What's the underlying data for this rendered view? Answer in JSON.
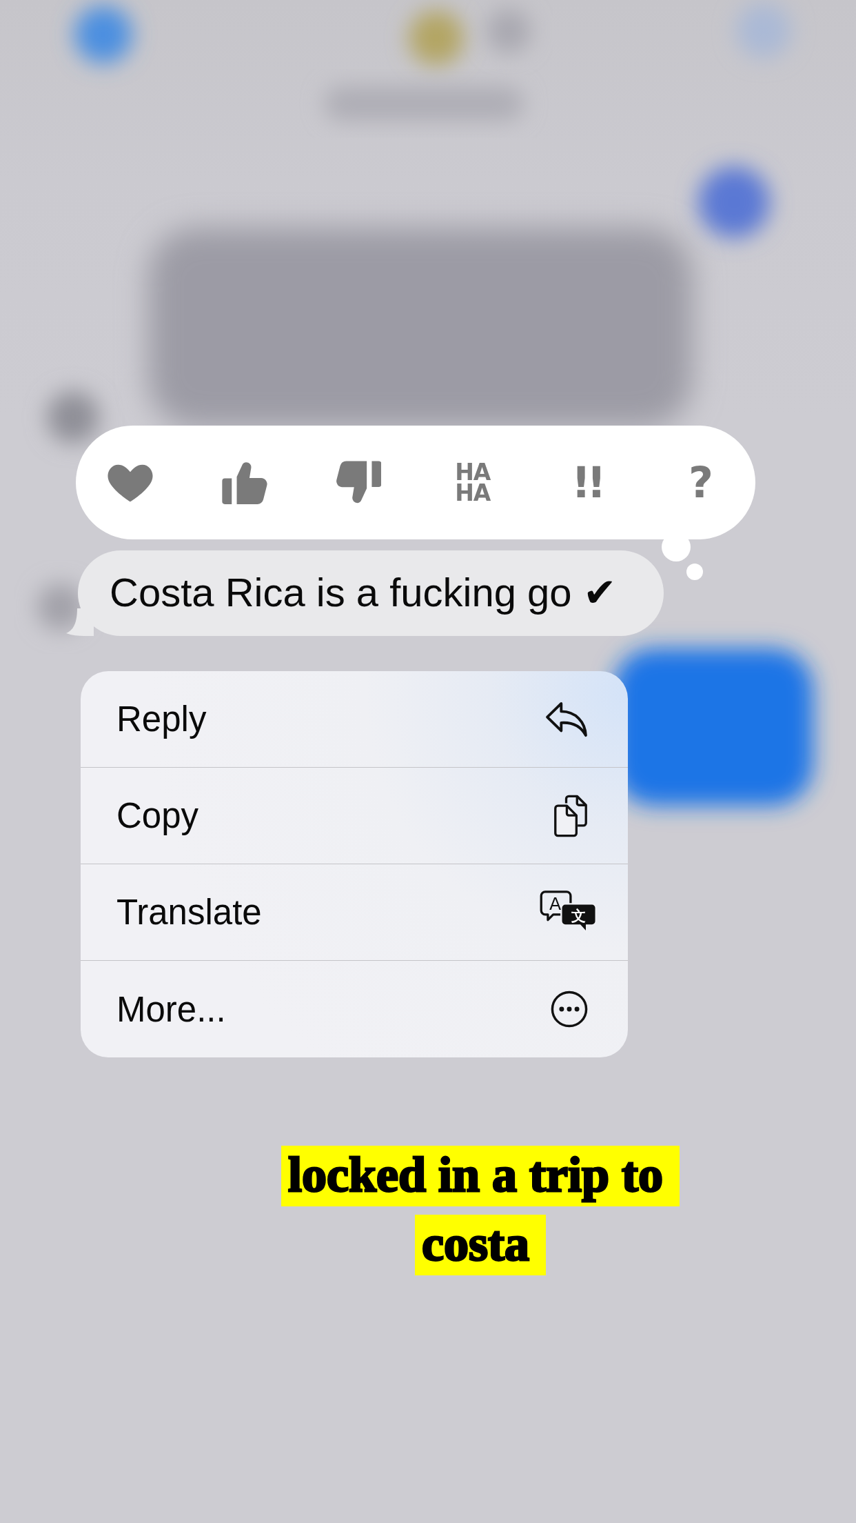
{
  "reactions": [
    {
      "kind": "heart",
      "selected": false
    },
    {
      "kind": "thumbs_up",
      "selected": false
    },
    {
      "kind": "thumbs_down",
      "selected": false
    },
    {
      "kind": "haha",
      "text": "HA HA",
      "selected": false
    },
    {
      "kind": "exclamation",
      "text": "!!",
      "selected": false
    },
    {
      "kind": "question",
      "text": "?",
      "selected": false
    }
  ],
  "message": {
    "text": "Costa Rica is a fucking go ✔"
  },
  "menu": [
    {
      "kind": "reply",
      "label": "Reply"
    },
    {
      "kind": "copy",
      "label": "Copy"
    },
    {
      "kind": "translate",
      "label": "Translate",
      "icon_text": [
        "A",
        "文"
      ]
    },
    {
      "kind": "more",
      "label": "More..."
    }
  ],
  "caption": {
    "lines": [
      "locked in a trip to",
      "costa"
    ]
  }
}
